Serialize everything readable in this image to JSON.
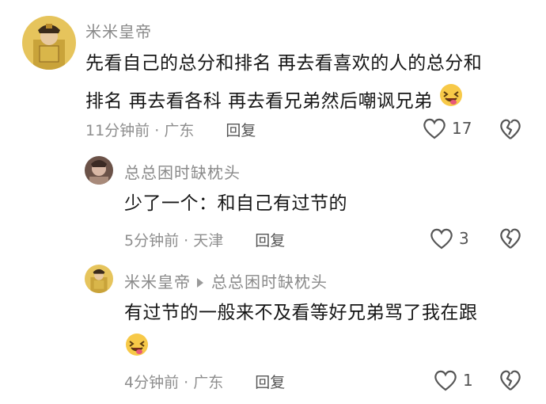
{
  "comments": [
    {
      "username": "米米皇帝",
      "text_line1": "先看自己的总分和排名 再去看喜欢的人的总分和",
      "text_line2": "排名 再去看各科 再去看兄弟然后嘲讽兄弟",
      "emoji": "laughing-tongue-emoji",
      "time": "11分钟前",
      "location": "广东",
      "reply_label": "回复",
      "likes": "17"
    },
    {
      "username": "总总困时缺枕头",
      "text": "少了一个：和自己有过节的",
      "time": "5分钟前",
      "location": "天津",
      "reply_label": "回复",
      "likes": "3"
    },
    {
      "username": "米米皇帝",
      "reply_to": "总总困时缺枕头",
      "text": "有过节的一般来不及看等好兄弟骂了我在跟",
      "emoji": "laughing-tongue-emoji",
      "time": "4分钟前",
      "location": "广东",
      "reply_label": "回复",
      "likes": "1"
    }
  ],
  "colors": {
    "meta": "#8e8e8e",
    "text": "#161616",
    "icon": "#555555"
  },
  "icons": [
    "heart-outline-icon",
    "broken-heart-icon",
    "triangle-arrow-icon"
  ]
}
